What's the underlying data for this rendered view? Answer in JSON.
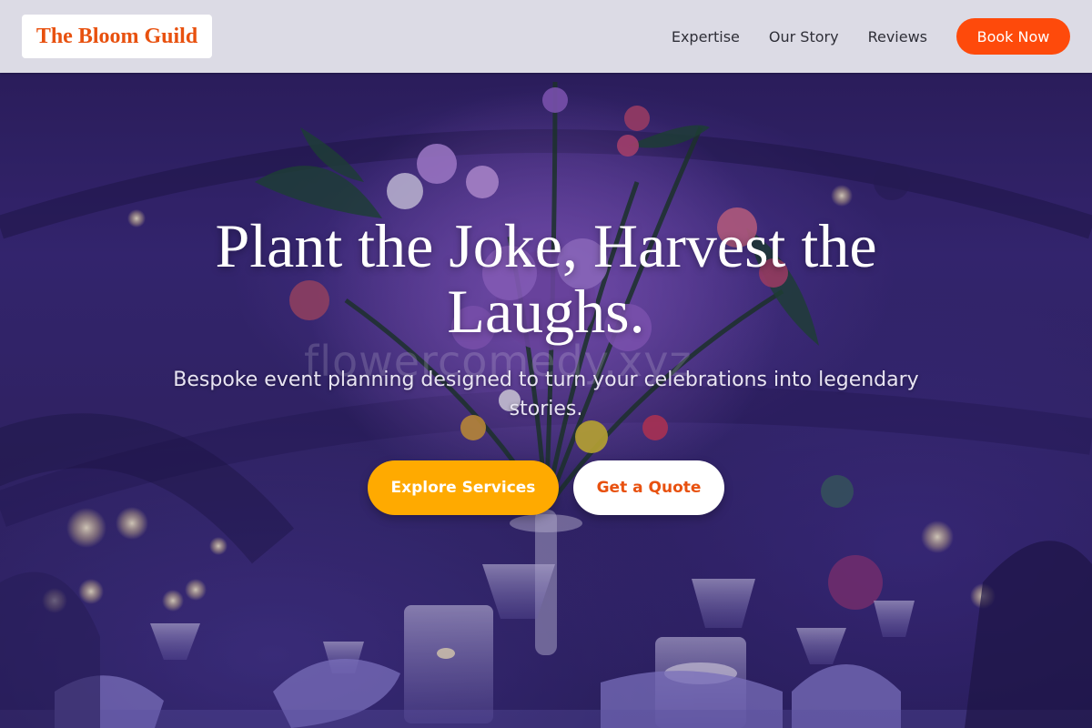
{
  "header": {
    "logo_text": "The Bloom Guild",
    "nav": [
      {
        "label": "Expertise"
      },
      {
        "label": "Our Story"
      },
      {
        "label": "Reviews"
      }
    ],
    "cta_label": "Book Now"
  },
  "hero": {
    "title": "Plant the Joke, Harvest the Laughs.",
    "subtitle": "Bespoke event planning designed to turn your celebrations into legendary stories.",
    "watermark": "flowercomedy.xyz",
    "primary_button": "Explore Services",
    "secondary_button": "Get a Quote"
  },
  "colors": {
    "accent_orange": "#fe4a0b",
    "logo_orange": "#e8510f",
    "amber": "#ffaa00",
    "hero_purple": "#35286e"
  }
}
